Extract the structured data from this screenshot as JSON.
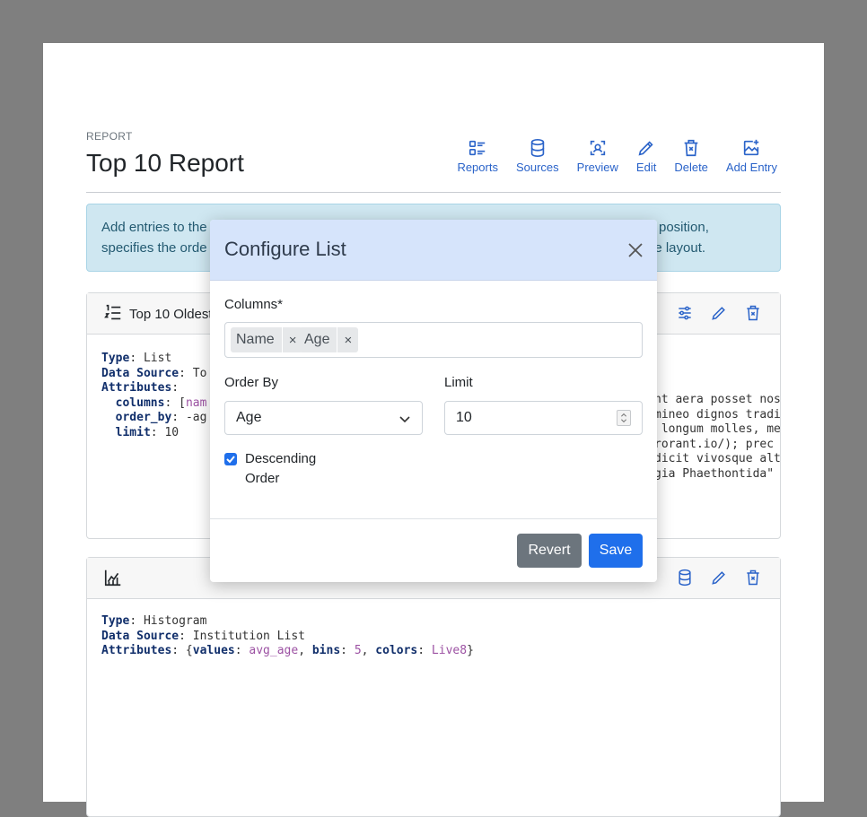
{
  "header": {
    "eyebrow": "REPORT",
    "title": "Top 10 Report"
  },
  "toolbar": [
    {
      "label": "Reports",
      "icon": "list-icon"
    },
    {
      "label": "Sources",
      "icon": "database-icon"
    },
    {
      "label": "Preview",
      "icon": "preview-icon"
    },
    {
      "label": "Edit",
      "icon": "pencil-icon"
    },
    {
      "label": "Delete",
      "icon": "trash-icon"
    },
    {
      "label": "Add Entry",
      "icon": "add-image-icon"
    }
  ],
  "alert": {
    "line1_left": "Add entries to the",
    "line1_right": "position,",
    "line2_left": "specifies the orde",
    "line2_right": "he layout."
  },
  "cards": {
    "list": {
      "title": "Top 10 Oldest",
      "code_type_key": "Type",
      "code_type_val": "List",
      "code_source_key": "Data Source",
      "code_source_val": "To",
      "code_attr_key": "Attributes",
      "columns_key": "columns",
      "columns_val_open": "[",
      "columns_val": "nam",
      "order_key": "order_by",
      "order_val": "-ag",
      "limit_key": "limit",
      "limit_val": "10",
      "right_lines": [
        "nt aera posset nos",
        "mineo dignos tradi",
        " longum molles, me",
        "rorant.io/); prec",
        "dicit vivosque alt",
        "gia Phaethontida\""
      ]
    },
    "histogram": {
      "code_type_key": "Type",
      "code_type_val": "Histogram",
      "code_source_key": "Data Source",
      "code_source_val": "Institution List",
      "code_attr_key": "Attributes",
      "values_key": "values",
      "values_val": "avg_age",
      "bins_key": "bins",
      "bins_val": "5",
      "colors_key": "colors",
      "colors_val": "Live8"
    }
  },
  "modal": {
    "title": "Configure List",
    "columns_label": "Columns*",
    "tags": [
      "Name",
      "Age"
    ],
    "tag_remove": "×",
    "order_label": "Order By",
    "order_value": "Age",
    "limit_label": "Limit",
    "limit_value": "10",
    "descending_label_1": "Descending",
    "descending_label_2": "Order",
    "descending_checked": true,
    "revert_label": "Revert",
    "save_label": "Save"
  },
  "colors": {
    "accent": "#1f6feb",
    "secondary": "#6c757d",
    "modal_header": "#d6e4fb",
    "alert_bg": "#cfe7f1"
  }
}
